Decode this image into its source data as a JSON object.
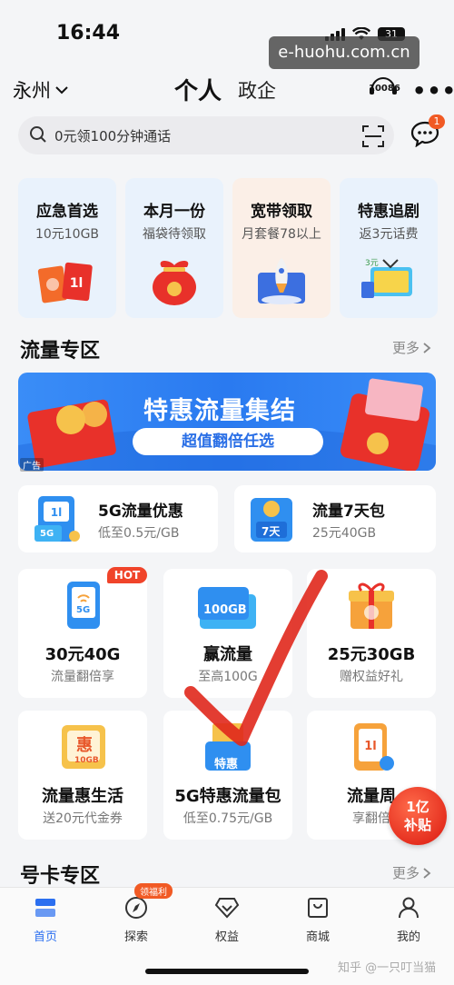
{
  "status": {
    "time": "16:44",
    "battery": "31",
    "watermark": "e-huohu.com.cn"
  },
  "header": {
    "city": "永州",
    "tab_personal": "个人",
    "tab_gov": "政企",
    "service_label": "10086"
  },
  "search": {
    "placeholder": "0元领100分钟通话",
    "msg_badge": "1"
  },
  "promos": [
    {
      "title": "应急首选",
      "sub": "10元10GB",
      "bg": "#eaf3fd"
    },
    {
      "title": "本月一份",
      "sub": "福袋待领取",
      "bg": "#eaf3fd"
    },
    {
      "title": "宽带领取",
      "sub": "月套餐78以上",
      "bg": "#fdf1ea"
    },
    {
      "title": "特惠追剧",
      "sub": "返3元话费",
      "bg": "#eaf3fd"
    }
  ],
  "flow_section": {
    "title": "流量专区",
    "more": "更多"
  },
  "banner": {
    "title": "特惠流量集结",
    "pill": "超值翻倍任选",
    "ad": "广告"
  },
  "flow_cards": [
    {
      "title": "5G流量优惠",
      "sub": "低至0.5元/GB",
      "icon_text": "5G"
    },
    {
      "title": "流量7天包",
      "sub": "25元40GB",
      "icon_text": "7天"
    }
  ],
  "grid_row1": [
    {
      "title": "30元40G",
      "sub": "流量翻倍享",
      "tag": "HOT",
      "icon_text": "5G"
    },
    {
      "title": "赢流量",
      "sub": "至高100G",
      "icon_text": "100GB"
    },
    {
      "title": "25元30GB",
      "sub": "赠权益好礼"
    }
  ],
  "grid_row2": [
    {
      "title": "流量惠生活",
      "sub": "送20元代金券",
      "icon_text": "惠",
      "icon_sub": "10GB"
    },
    {
      "title": "5G特惠流量包",
      "sub": "低至0.75元/GB",
      "icon_text": "特惠"
    },
    {
      "title": "流量周",
      "sub": "享翻倍"
    }
  ],
  "fab": {
    "line1": "1亿",
    "line2": "补贴"
  },
  "card_section": {
    "title": "号卡专区",
    "more": "更多"
  },
  "nav": {
    "items": [
      {
        "label": "首页"
      },
      {
        "label": "探索"
      },
      {
        "label": "权益"
      },
      {
        "label": "商城"
      },
      {
        "label": "我的"
      }
    ],
    "badge": "领福利"
  },
  "credit": "知乎 @一只叮当猫",
  "colors": {
    "accent": "#2b6ff0",
    "hot": "#f0442a",
    "badge": "#f15a24",
    "bg": "#f4f5f7",
    "check_mark": "#e0281c"
  }
}
